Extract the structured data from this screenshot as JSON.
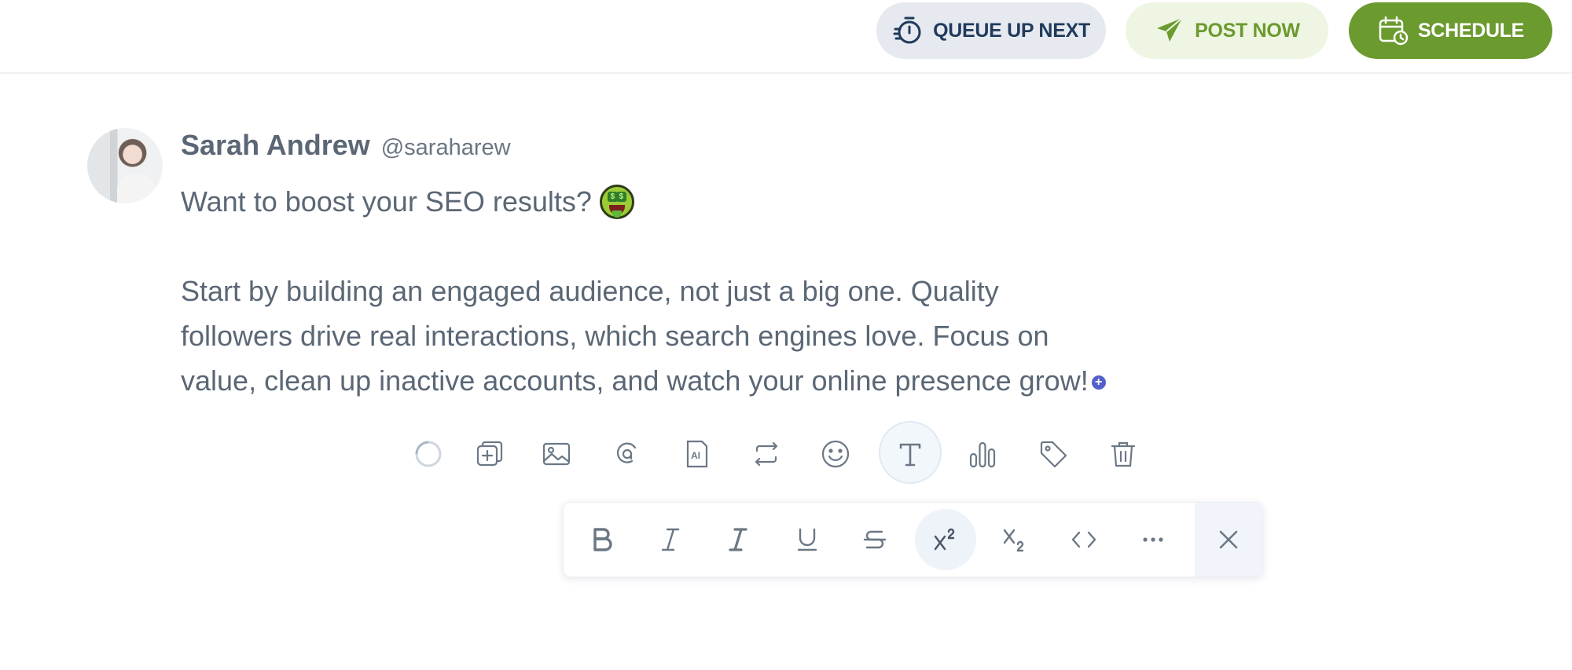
{
  "header": {
    "queue_label": "QUEUE UP NEXT",
    "post_label": "POST NOW",
    "schedule_label": "SCHEDULE"
  },
  "post": {
    "author_name": "Sarah Andrew",
    "author_handle": "@saraharew",
    "line1": "Want to boost your SEO results?",
    "para_lines": [
      "Start by building an engaged audience, not just a big one. Quality",
      "followers drive real interactions, which search engines love. Focus on",
      "value, clean up inactive accounts, and watch your online presence grow!"
    ]
  },
  "toolbar_icons": [
    "spinner-icon",
    "add-post-icon",
    "image-icon",
    "gif-icon",
    "ai-icon",
    "repost-icon",
    "emoji-icon",
    "text-format-icon",
    "poll-icon",
    "tag-icon",
    "trash-icon"
  ],
  "format_icons": [
    "bold-icon",
    "italic-icon",
    "italic-serif-icon",
    "underline-icon",
    "strikethrough-icon",
    "superscript-icon",
    "subscript-icon",
    "code-icon",
    "more-icon",
    "close-icon"
  ],
  "colors": {
    "brand_green": "#6b9a2e",
    "accent_purple": "#5360c9"
  }
}
